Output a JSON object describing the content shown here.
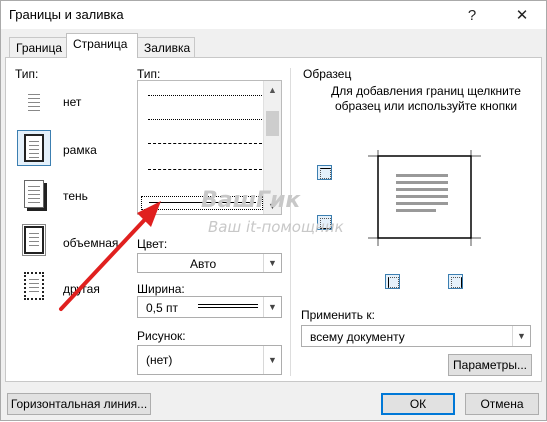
{
  "window": {
    "title": "Границы и заливка",
    "help_icon": "?",
    "close_icon": "✕"
  },
  "tabs": [
    {
      "label": "Граница",
      "active": false
    },
    {
      "label": "Страница",
      "active": true
    },
    {
      "label": "Заливка",
      "active": false
    }
  ],
  "setting": {
    "label": "Тип:",
    "types": [
      {
        "label": "нет",
        "selected": false
      },
      {
        "label": "рамка",
        "selected": true
      },
      {
        "label": "тень",
        "selected": false
      },
      {
        "label": "объемная",
        "selected": false
      },
      {
        "label": "другая",
        "selected": false
      }
    ]
  },
  "style": {
    "label": "Тип:",
    "color_label": "Цвет:",
    "color_value": "Авто",
    "width_label": "Ширина:",
    "width_value": "0,5 пт",
    "art_label": "Рисунок:",
    "art_value": "(нет)"
  },
  "preview": {
    "label": "Образец",
    "hint": "Для добавления границ щелкните образец или используйте кнопки",
    "apply_label": "Применить к:",
    "apply_value": "всему документу",
    "options_button": "Параметры..."
  },
  "footer": {
    "horizontal_line_button": "Горизонтальная линия...",
    "ok_button": "ОК",
    "cancel_button": "Отмена"
  },
  "watermark": {
    "line1": "ВашГик",
    "line2": "Ваш it-помощник"
  },
  "colors": {
    "accent": "#3c7fb1",
    "arrow": "#e0201f",
    "default_border": "#0078d7"
  }
}
